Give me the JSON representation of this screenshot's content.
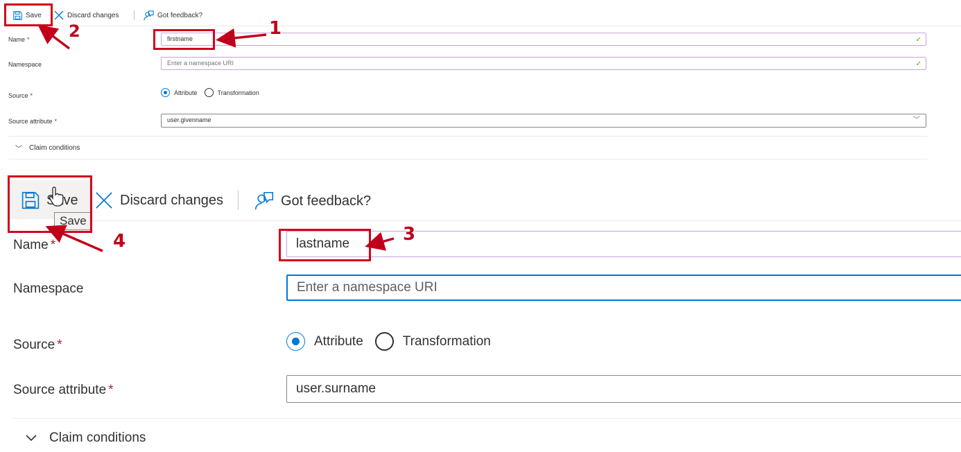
{
  "top_panel": {
    "toolbar": {
      "save_label": "Save",
      "discard_label": "Discard changes",
      "feedback_label": "Got feedback?"
    },
    "form": {
      "name_label": "Name",
      "name_value": "firstname",
      "namespace_label": "Namespace",
      "namespace_placeholder": "Enter a namespace URI",
      "source_label": "Source",
      "source_options": [
        "Attribute",
        "Transformation"
      ],
      "source_selected": "Attribute",
      "source_attribute_label": "Source attribute",
      "source_attribute_value": "user.givenname",
      "claim_conditions_label": "Claim conditions"
    }
  },
  "bottom_panel": {
    "toolbar": {
      "save_label": "Save",
      "discard_label": "Discard changes",
      "feedback_label": "Got feedback?",
      "save_tooltip": "Save"
    },
    "form": {
      "name_label": "Name",
      "name_value": "lastname",
      "namespace_label": "Namespace",
      "namespace_placeholder": "Enter a namespace URI",
      "source_label": "Source",
      "source_options": [
        "Attribute",
        "Transformation"
      ],
      "source_selected": "Attribute",
      "source_attribute_label": "Source attribute",
      "source_attribute_value": "user.surname",
      "claim_conditions_label": "Claim conditions"
    }
  },
  "annotations": {
    "steps": [
      "1",
      "2",
      "3",
      "4"
    ],
    "color": "#d0021b"
  },
  "colors": {
    "accent": "#0078d4",
    "required": "#a4262c",
    "valid_check": "#57a300",
    "focused_border": "#c8a5d9"
  },
  "icons": [
    "save-icon",
    "close-icon",
    "feedback-icon",
    "checkmark-icon",
    "chevron-down-icon",
    "hand-cursor-icon"
  ]
}
